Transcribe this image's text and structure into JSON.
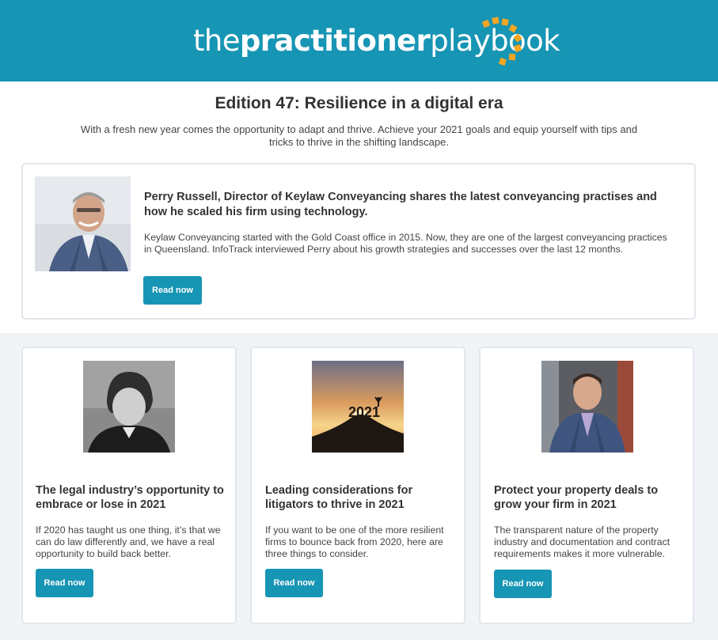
{
  "header": {
    "brand_the": "the",
    "brand_practitioner": "practitioner",
    "brand_playbook": "playbook",
    "brand_color": "#1795b4",
    "accent_color": "#f5a623"
  },
  "edition": {
    "title": "Edition 47: Resilience in a digital era",
    "subtitle": "With a fresh new year comes the opportunity to adapt and thrive. Achieve your 2021 goals and equip yourself with tips and tricks to thrive in the shifting landscape."
  },
  "feature": {
    "photo_alt": "portrait-photo",
    "title": "Perry Russell, Director of Keylaw Conveyancing shares the latest conveyancing practises and how he scaled his firm using technology.",
    "body": "Keylaw Conveyancing started with the Gold Coast office in 2015. Now, they are one of the largest conveyancing practices in Queensland. InfoTrack interviewed Perry about his growth strategies and successes over the last 12 months.",
    "button": "Read now"
  },
  "articles": [
    {
      "title": "The legal industry’s opportunity to embrace or lose in 2021",
      "body": "If 2020 has taught us one thing, it’s that we can do law differently and, we have a real opportunity to build back better.",
      "button": "Read now"
    },
    {
      "title": "Leading considerations for litigators to thrive in 2021",
      "body": "If you want to be one of the more resilient firms to bounce back from 2020, here are three things to consider.",
      "button": "Read now",
      "image_text": "2021"
    },
    {
      "title": "Protect your property deals to grow your  firm in 2021",
      "body": "The transparent nature of the property industry and documentation and contract requirements makes it more vulnerable.",
      "button": "Read now"
    }
  ]
}
